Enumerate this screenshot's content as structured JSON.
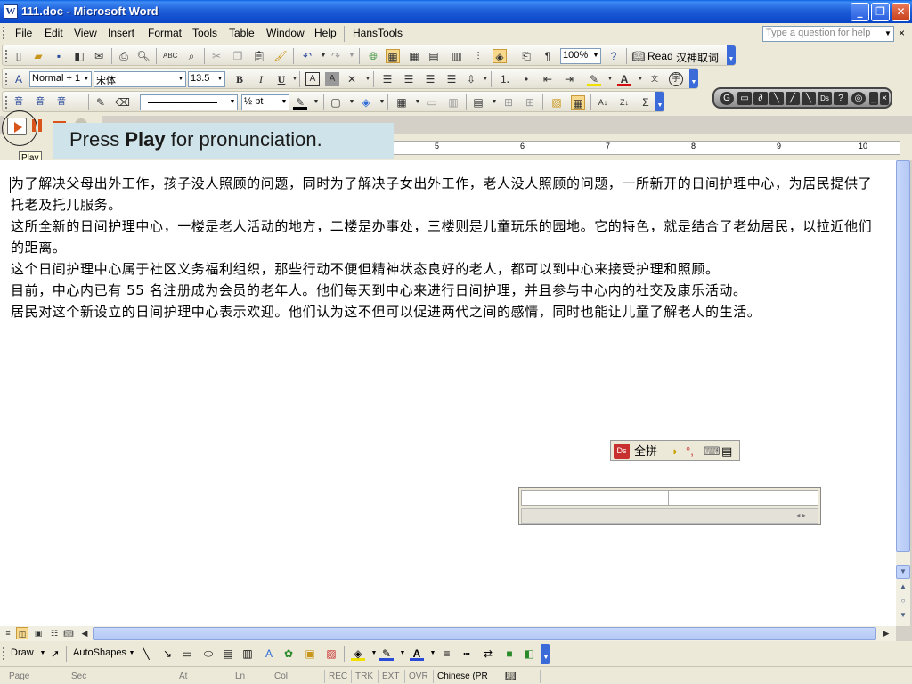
{
  "window": {
    "title": "111.doc - Microsoft Word",
    "app_icon": "word-doc-icon",
    "controls": [
      "minimize",
      "restore",
      "close"
    ]
  },
  "menu": {
    "items": [
      "File",
      "Edit",
      "View",
      "Insert",
      "Format",
      "Tools",
      "Table",
      "Window",
      "Help",
      "HansTools"
    ],
    "help_placeholder": "Type a question for help",
    "doc_close": "×"
  },
  "standard_toolbar": {
    "zoom": "100%",
    "read_label": "Read",
    "chinese_read_label": "汉神取词"
  },
  "formatting_toolbar": {
    "style": "Normal + 1",
    "font": "宋体",
    "size": "13.5",
    "bold": "B",
    "italic": "I",
    "underline": "U"
  },
  "tables_toolbar": {
    "line_weight": "½ pt"
  },
  "play_toolbar": {
    "tooltip": "Play"
  },
  "callout": {
    "prefix": "Press ",
    "bold": "Play",
    "suffix": " for pronunciation."
  },
  "ruler": {
    "marks": [
      "5",
      "6",
      "7",
      "8",
      "9",
      "10"
    ]
  },
  "document": {
    "paragraphs": [
      "为了解决父母出外工作，孩子没人照顾的问题，同时为了解决子女出外工作，老人没人照顾的问题，一所新开的日间护理中心，为居民提供了托老及托儿服务。",
      "这所全新的日间护理中心，一楼是老人活动的地方，二楼是办事处，三楼则是儿童玩乐的园地。它的特色，就是结合了老幼居民，以拉近他们的距离。",
      "这个日间护理中心属于社区义务福利组织，那些行动不便但精神状态良好的老人，都可以到中心来接受护理和照顾。",
      "目前，中心内已有 55 名注册成为会员的老年人。他们每天到中心来进行日间护理，并且参与中心内的社交及康乐活动。",
      "居民对这个新设立的日间护理中心表示欢迎。他们认为这不但可以促进两代之间的感情，同时也能让儿童了解老人的生活。"
    ]
  },
  "ime_bar": {
    "mode": "全拼"
  },
  "draw_toolbar": {
    "draw": "Draw",
    "autoshapes": "AutoShapes"
  },
  "status": {
    "page": "Page",
    "sec": "Sec",
    "at": "At",
    "ln": "Ln",
    "col": "Col",
    "rec": "REC",
    "trk": "TRK",
    "ext": "EXT",
    "ovr": "OVR",
    "language": "Chinese (PR"
  }
}
